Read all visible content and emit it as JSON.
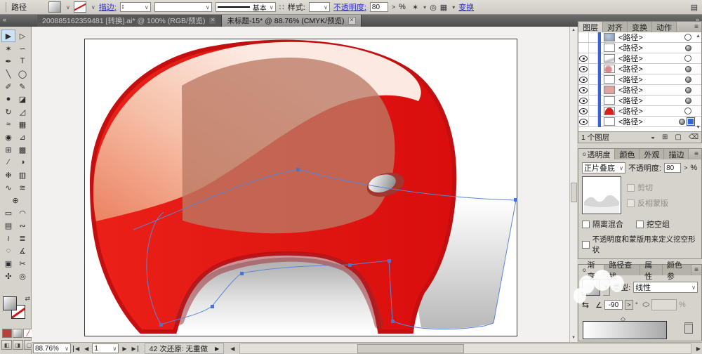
{
  "icons": {
    "dropdown": "∨",
    "dd_small": "▾",
    "spin_up": "▴",
    "spin_down": "▾",
    "close": "×",
    "chev_left": "«",
    "chev_right": "»",
    "menu": "≡",
    "up": "▲",
    "down": "▼",
    "left": "◀",
    "right": "▶",
    "percent": "%",
    "gt": ">",
    "degree": "°",
    "angle": "∠",
    "swap": "⇄",
    "reverse": "⇆",
    "aspect": "⬭",
    "dots": "∷",
    "wand": "✶",
    "globe": "◎",
    "grid": "▦",
    "panel_list": "▤"
  },
  "control_bar": {
    "selection_label": "路径",
    "stroke_label": "描边:",
    "brush_label": "基本",
    "style_label": "样式:",
    "opacity_label": "不透明度:",
    "opacity_value": "80",
    "transform_label": "变换"
  },
  "tabs": [
    {
      "title": "200885162359481 [转换].ai* @ 100% (RGB/预览)",
      "active": false
    },
    {
      "title": "未标题-15* @ 88.76% (CMYK/预览)",
      "active": true
    }
  ],
  "toolbar": {
    "tools": [
      {
        "name": "selection",
        "glyph": "▶",
        "active": true
      },
      {
        "name": "direct-selection",
        "glyph": "▷"
      },
      {
        "name": "magic-wand",
        "glyph": "✶"
      },
      {
        "name": "lasso",
        "glyph": "∽"
      },
      {
        "name": "pen",
        "glyph": "✒"
      },
      {
        "name": "type",
        "glyph": "T"
      },
      {
        "name": "line-segment",
        "glyph": "╲"
      },
      {
        "name": "ellipse",
        "glyph": "◯"
      },
      {
        "name": "paintbrush",
        "glyph": "✐"
      },
      {
        "name": "pencil",
        "glyph": "✎"
      },
      {
        "name": "blob-brush",
        "glyph": "●"
      },
      {
        "name": "eraser",
        "glyph": "◪"
      },
      {
        "name": "rotate",
        "glyph": "↻"
      },
      {
        "name": "scale",
        "glyph": "◿"
      },
      {
        "name": "width",
        "glyph": "≈"
      },
      {
        "name": "free-transform",
        "glyph": "▦"
      },
      {
        "name": "shape-builder",
        "glyph": "◉"
      },
      {
        "name": "perspective-grid",
        "glyph": "⊿"
      },
      {
        "name": "mesh",
        "glyph": "⊞"
      },
      {
        "name": "gradient",
        "glyph": "▩"
      },
      {
        "name": "eyedropper",
        "glyph": "⁄"
      },
      {
        "name": "blend",
        "glyph": "◑"
      },
      {
        "name": "symbol-sprayer",
        "glyph": "❉"
      },
      {
        "name": "column-graph",
        "glyph": "▥"
      },
      {
        "name": "curvature",
        "glyph": "∿"
      },
      {
        "name": "warp",
        "glyph": "≋"
      },
      {
        "name": "perspective",
        "glyph": "⊕",
        "single": true
      },
      {
        "name": "reshape",
        "glyph": "▭"
      },
      {
        "name": "arc",
        "glyph": "◠"
      },
      {
        "name": "live-paint",
        "glyph": "▤"
      },
      {
        "name": "wrinkle",
        "glyph": "∾"
      },
      {
        "name": "scribble",
        "glyph": "≀"
      },
      {
        "name": "paragraph",
        "glyph": "≣"
      },
      {
        "name": "lasso-select",
        "glyph": "◌"
      },
      {
        "name": "measure",
        "glyph": "∡"
      },
      {
        "name": "artboard",
        "glyph": "▣"
      },
      {
        "name": "slice",
        "glyph": "✂"
      },
      {
        "name": "hand",
        "glyph": "✣"
      },
      {
        "name": "zoom",
        "glyph": "◎"
      }
    ]
  },
  "panels": {
    "panel_dot": "o",
    "group1_tabs": [
      "图层",
      "对齐",
      "变换",
      "动作"
    ],
    "layers": {
      "rows": [
        {
          "label": "<路径>",
          "eye": false,
          "thumb": "blue",
          "target": "ring"
        },
        {
          "label": "<路径>",
          "eye": false,
          "thumb": "white",
          "target": "sphere"
        },
        {
          "label": "<路径>",
          "eye": true,
          "thumb": "graydiag",
          "target": "ring"
        },
        {
          "label": "<路径>",
          "eye": true,
          "thumb": "pinkblob",
          "target": "sphere"
        },
        {
          "label": "<路径>",
          "eye": true,
          "thumb": "white2",
          "target": "sphere"
        },
        {
          "label": "<路径>",
          "eye": true,
          "thumb": "pinksq",
          "target": "sphere"
        },
        {
          "label": "<路径>",
          "eye": true,
          "thumb": "white3",
          "target": "sphere"
        },
        {
          "label": "<路径>",
          "eye": true,
          "thumb": "redshape",
          "target": "ring"
        },
        {
          "label": "<路径>",
          "eye": true,
          "thumb": "white",
          "target": "sphere",
          "selected": true
        }
      ],
      "footer": "1 个图层"
    },
    "transparency": {
      "tabs": [
        "透明度",
        "颜色",
        "外观",
        "描边"
      ],
      "blend_mode": "正片叠底",
      "opacity_label": "不透明度:",
      "opacity_value": "80",
      "checkboxes": [
        "剪切",
        "反相蒙版",
        "隔离混合",
        "挖空组",
        "不透明度和蒙版用来定义挖空形状"
      ]
    },
    "gradient": {
      "tabs": [
        "渐变",
        "路径查找",
        "属性",
        "颜色参"
      ],
      "type_label": "类型:",
      "type_value": "线性",
      "angle_value": "-90"
    }
  },
  "statusbar": {
    "zoom": "88.76%",
    "artboard_nav": "1",
    "status": "42 次还原: 无重做"
  },
  "colors": {
    "helmet_red": "#e41511",
    "helmet_rim": "#c30f10",
    "highlight_salmon": "#f6c5ac",
    "visor_tan": "#bb7a64",
    "path_blue": "#5b86d6",
    "link_blue": "#2b2bd6",
    "layer_bar_blue": "#3a63cf"
  }
}
